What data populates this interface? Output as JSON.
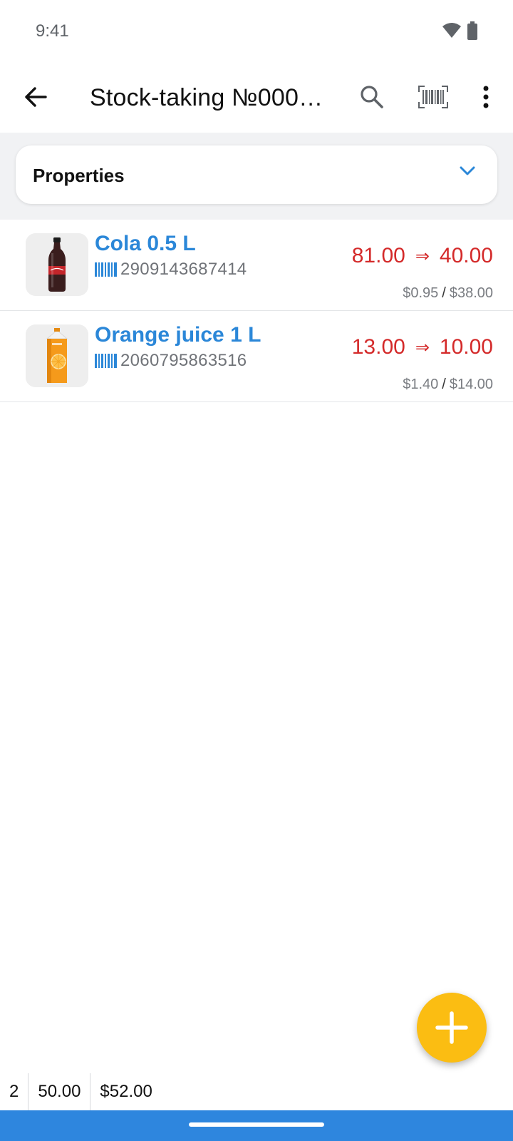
{
  "status_bar": {
    "time": "9:41",
    "icons": [
      "wifi-icon",
      "battery-icon"
    ]
  },
  "app_bar": {
    "title": "Stock-taking №000…",
    "actions": [
      "back-arrow-icon",
      "search-icon",
      "barcode-scan-icon",
      "more-vert-icon"
    ]
  },
  "properties": {
    "label": "Properties",
    "expanded": false
  },
  "items": [
    {
      "name": "Cola 0.5 L",
      "barcode": "2909143687414",
      "qty_from": "81.00",
      "qty_to": "40.00",
      "price": "$0.95",
      "total": "$38.00",
      "image": "cola-bottle-image"
    },
    {
      "name": "Orange juice 1 L",
      "barcode": "2060795863516",
      "qty_from": "13.00",
      "qty_to": "10.00",
      "price": "$1.40",
      "total": "$14.00",
      "image": "orange-juice-carton-image"
    }
  ],
  "arrow_symbol": "⇒",
  "price_separator": "/",
  "footer": {
    "count": "2",
    "quantity": "50.00",
    "sum": "$52.00"
  },
  "colors": {
    "accent_blue": "#2b87d8",
    "quantity_red": "#d42a2a",
    "fab_yellow": "#fbbd12",
    "nav_bar": "#2e86de"
  }
}
